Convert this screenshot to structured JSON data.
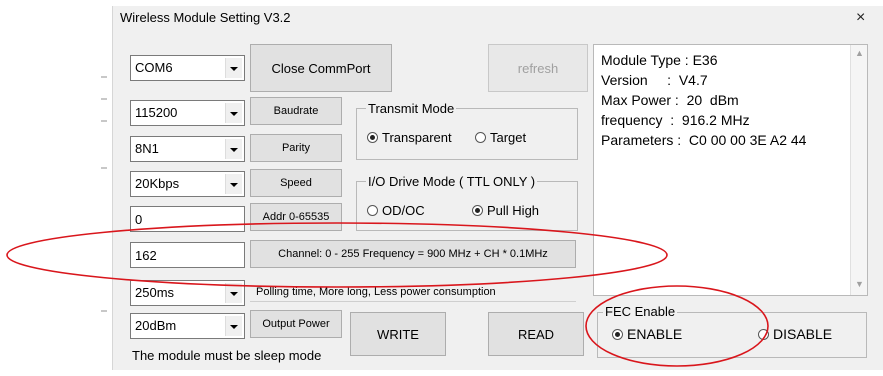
{
  "window": {
    "title": "Wireless Module Setting V3.2",
    "close_glyph": "×"
  },
  "port": {
    "com": "COM6",
    "close_commport_label": "Close CommPort",
    "refresh_label": "refresh"
  },
  "settings": {
    "baud_value": "115200",
    "baud_label": "Baudrate",
    "parity_value": "8N1",
    "parity_label": "Parity",
    "speed_value": "20Kbps",
    "speed_label": "Speed",
    "addr_value": "0",
    "addr_label": "Addr 0-65535",
    "channel_value": "162",
    "channel_label": "Channel: 0 - 255 Frequency = 900 MHz + CH * 0.1MHz",
    "polling_value": "250ms",
    "polling_label": "Polling time, More long, Less power consumption",
    "power_value": "20dBm",
    "power_label": "Output Power"
  },
  "transmit_mode": {
    "title": "Transmit Mode",
    "options": [
      "Transparent",
      "Target"
    ],
    "selected": "Transparent"
  },
  "io_mode": {
    "title": "I/O Drive Mode ( TTL ONLY )",
    "options": [
      "OD/OC",
      "Pull High"
    ],
    "selected": "Pull High"
  },
  "actions": {
    "write_label": "WRITE",
    "read_label": "READ"
  },
  "fec": {
    "title": "FEC Enable",
    "options": [
      "ENABLE",
      "DISABLE"
    ],
    "selected": "ENABLE"
  },
  "info": {
    "lines": [
      "Module Type : E36",
      "Version     :  V4.7",
      "Max Power :  20  dBm",
      "frequency  :  916.2 MHz",
      "Parameters :  C0 00 00 3E A2 44"
    ]
  },
  "footer": {
    "note": "The module must be sleep mode"
  },
  "annotations": {
    "ellipse_color": "#d9161c"
  }
}
